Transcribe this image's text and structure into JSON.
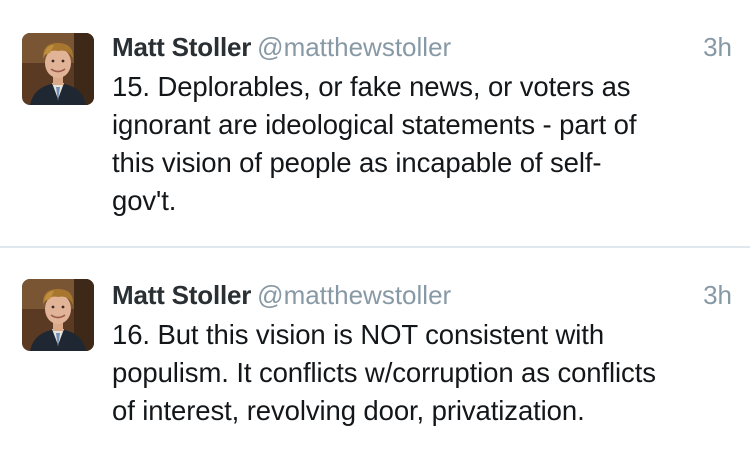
{
  "tweets": [
    {
      "author_name": "Matt Stoller",
      "handle": "@matthewstoller",
      "time": "3h",
      "text": "15. Deplorables, or fake news, or voters as\nignorant are ideological statements - part of\nthis vision of people as incapable of self-\ngov't.",
      "avatar_icon": "profile-photo"
    },
    {
      "author_name": "Matt Stoller",
      "handle": "@matthewstoller",
      "time": "3h",
      "text": "16. But this vision is NOT consistent with\npopulism. It conflicts w/corruption as conflicts\nof interest, revolving door, privatization.",
      "avatar_icon": "profile-photo"
    }
  ],
  "colors": {
    "name": "#292f33",
    "meta": "#8899a6",
    "text": "#14171a",
    "divider": "#e1e8ed"
  }
}
